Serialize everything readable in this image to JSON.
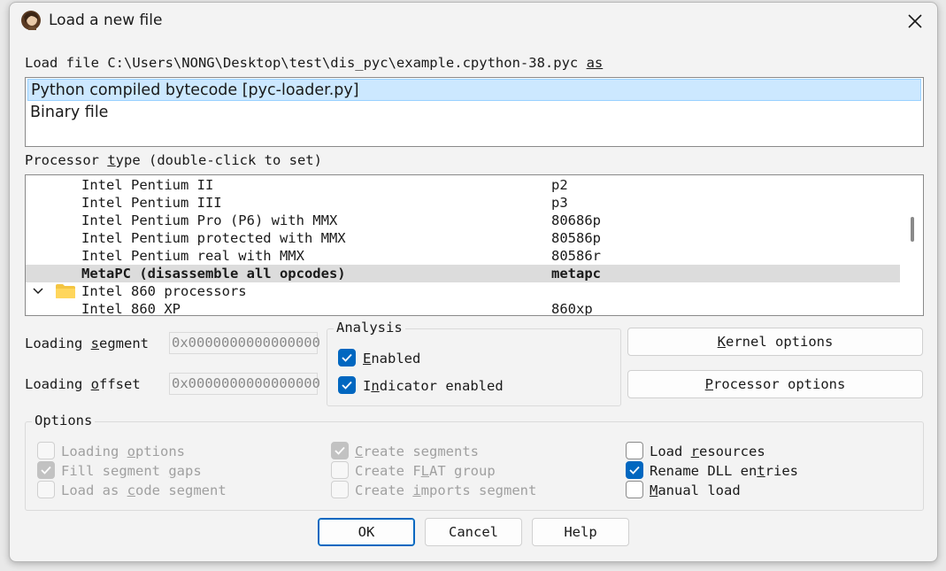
{
  "dialog": {
    "title": "Load a new file",
    "load_file_prefix": "Load file C:\\Users\\NONG\\Desktop\\test\\dis_pyc\\example.cpython-38.pyc ",
    "load_file_as": "as"
  },
  "loaders": [
    {
      "label": "Python compiled bytecode [pyc-loader.py]",
      "selected": true
    },
    {
      "label": "Binary file",
      "selected": false
    }
  ],
  "processor": {
    "label_a": "Processor ",
    "label_t": "t",
    "label_b": "ype (double-click to set)",
    "rows": [
      {
        "name": "Intel Pentium II",
        "code": "p2"
      },
      {
        "name": "Intel Pentium III",
        "code": "p3"
      },
      {
        "name": "Intel Pentium Pro (P6) with MMX",
        "code": "80686p"
      },
      {
        "name": "Intel Pentium protected with MMX",
        "code": "80586p"
      },
      {
        "name": "Intel Pentium real with MMX",
        "code": "80586r"
      },
      {
        "name": "MetaPC (disassemble all opcodes)",
        "code": "metapc"
      },
      {
        "name": "Intel 860 processors",
        "code": ""
      },
      {
        "name": "Intel 860 XP",
        "code": "860xp"
      }
    ]
  },
  "segment": {
    "loading_segment_a": "Loading ",
    "loading_segment_u": "s",
    "loading_segment_b": "egment",
    "loading_segment_value": "0x0000000000000000",
    "loading_offset_a": "Loading ",
    "loading_offset_u": "o",
    "loading_offset_b": "ffset",
    "loading_offset_value": "0x0000000000000000"
  },
  "analysis": {
    "title": "Analysis",
    "enabled_u": "E",
    "enabled_rest": "nabled",
    "indicator_a": "I",
    "indicator_u": "n",
    "indicator_b": "dicator enabled"
  },
  "buttons": {
    "kernel_u": "K",
    "kernel_rest": "ernel options",
    "processor_u": "P",
    "processor_rest": "rocessor options",
    "ok": "OK",
    "cancel": "Cancel",
    "help": "Help"
  },
  "options": {
    "title": "Options",
    "loading_options_a": "Loading ",
    "loading_options_u": "o",
    "loading_options_b": "ptions",
    "fill_gaps_a": "Fill segment ",
    "fill_gaps_u": "g",
    "fill_gaps_b": "aps",
    "code_seg_a": "Load as ",
    "code_seg_u": "c",
    "code_seg_b": "ode segment",
    "create_seg_u": "C",
    "create_seg_rest": "reate segments",
    "flat_a": "Create F",
    "flat_u": "L",
    "flat_b": "AT group",
    "imports_a": "Create ",
    "imports_u": "i",
    "imports_b": "mports segment",
    "resources_a": "Load ",
    "resources_u": "r",
    "resources_b": "esources",
    "rename_a": "Rename DLL en",
    "rename_u": "t",
    "rename_b": "ries",
    "manual_u": "M",
    "manual_rest": "anual load"
  },
  "colors": {
    "accent": "#0067c0",
    "selection": "#cce8ff",
    "highlight_row": "#dcdcdc"
  }
}
